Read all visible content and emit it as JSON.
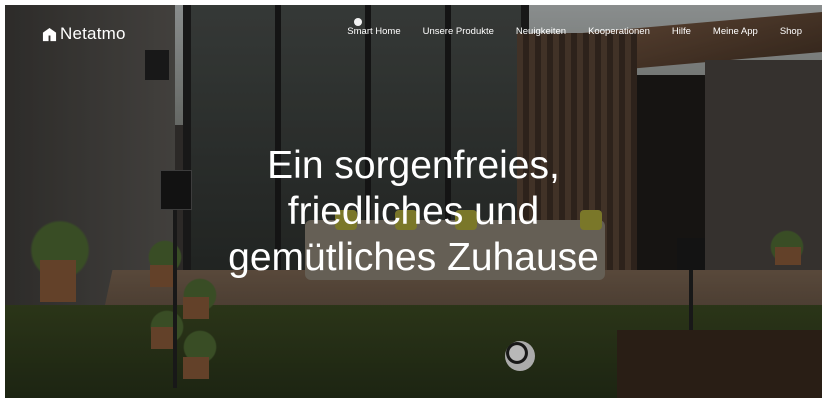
{
  "brand": {
    "name": "Netatmo",
    "icon": "netatmo-logo-icon"
  },
  "nav": {
    "items": [
      "Smart Home",
      "Unsere Produkte",
      "Neuigkeiten",
      "Kooperationen",
      "Hilfe",
      "Meine App",
      "Shop"
    ],
    "active_indicator": "Smart Home"
  },
  "hero": {
    "headline_lines": [
      "Ein sorgenfreies,",
      "friedliches und",
      "gemütliches Zuhause"
    ]
  },
  "colors": {
    "text": "#ffffff",
    "overlay": "#00000047"
  }
}
